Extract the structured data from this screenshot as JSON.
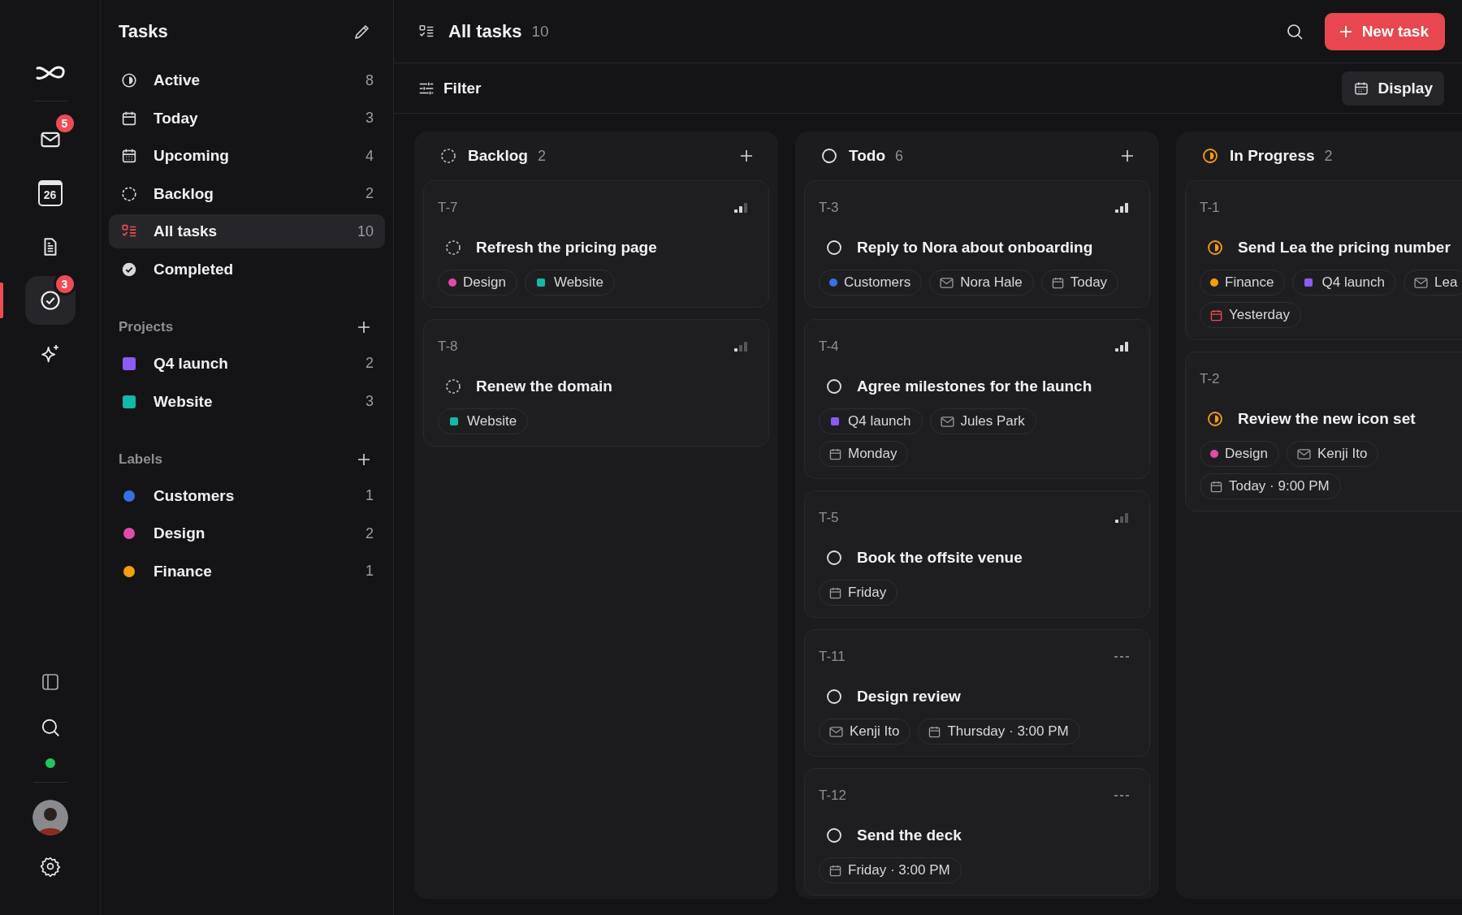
{
  "rail": {
    "top": [
      {
        "kind": "mail",
        "badge": "5",
        "selected": false
      },
      {
        "kind": "calendar",
        "day": "26",
        "selected": false
      },
      {
        "kind": "document",
        "selected": false
      },
      {
        "kind": "tasks",
        "badge": "3",
        "selected": true
      },
      {
        "kind": "sparkle",
        "selected": false
      }
    ],
    "bottom": [
      {
        "kind": "panel"
      },
      {
        "kind": "search"
      },
      {
        "kind": "status",
        "online": true
      },
      {
        "kind": "avatar"
      },
      {
        "kind": "settings"
      }
    ]
  },
  "sidebar": {
    "title": "Tasks",
    "views": [
      {
        "kind": "active",
        "label": "Active",
        "count": "8",
        "selected": false
      },
      {
        "kind": "today",
        "label": "Today",
        "count": "3",
        "selected": false
      },
      {
        "kind": "upcoming",
        "label": "Upcoming",
        "count": "4",
        "selected": false
      },
      {
        "kind": "backlog",
        "label": "Backlog",
        "count": "2",
        "selected": false
      },
      {
        "kind": "all",
        "label": "All tasks",
        "count": "10",
        "selected": true
      },
      {
        "kind": "completed",
        "label": "Completed",
        "selected": false
      }
    ],
    "projects": {
      "title": "Projects",
      "items": [
        {
          "label": "Q4 launch",
          "count": "2",
          "color": "#8b5cf6"
        },
        {
          "label": "Website",
          "count": "3",
          "color": "#14b8a6"
        }
      ]
    },
    "labels": {
      "title": "Labels",
      "items": [
        {
          "label": "Customers",
          "count": "1",
          "color": "#3b6fe8"
        },
        {
          "label": "Design",
          "count": "2",
          "color": "#e04ba8"
        },
        {
          "label": "Finance",
          "count": "1",
          "color": "#f59e0b"
        }
      ]
    }
  },
  "header": {
    "title": "All tasks",
    "count": "10",
    "new_button": "New task",
    "filter": "Filter",
    "display": "Display"
  },
  "columns": [
    {
      "kind": "backlog",
      "title": "Backlog",
      "count": "2",
      "cards": [
        {
          "id": "T-7",
          "kind": "medium",
          "title": "Refresh the pricing page",
          "chip_rows": [
            [
              {
                "kind": "label",
                "text": "Design",
                "color": "#e04ba8"
              },
              {
                "kind": "project",
                "text": "Website",
                "color": "#14b8a6"
              }
            ]
          ]
        },
        {
          "id": "T-8",
          "kind": "low",
          "title": "Renew the domain",
          "chip_rows": [
            [
              {
                "kind": "project",
                "text": "Website",
                "color": "#14b8a6"
              }
            ]
          ]
        }
      ]
    },
    {
      "kind": "todo",
      "title": "Todo",
      "count": "6",
      "cards": [
        {
          "id": "T-3",
          "kind": "high",
          "title": "Reply to Nora about onboarding",
          "chip_rows": [
            [
              {
                "kind": "label",
                "text": "Customers",
                "color": "#3b6fe8"
              },
              {
                "kind": "person",
                "text": "Nora Hale"
              },
              {
                "kind": "date",
                "text": "Today",
                "overdue": false
              }
            ]
          ]
        },
        {
          "id": "T-4",
          "kind": "high",
          "title": "Agree milestones for the launch",
          "chip_rows": [
            [
              {
                "kind": "project",
                "text": "Q4 launch",
                "color": "#8b5cf6"
              },
              {
                "kind": "person",
                "text": "Jules Park"
              }
            ],
            [
              {
                "kind": "date",
                "text": "Monday",
                "overdue": false
              }
            ]
          ]
        },
        {
          "id": "T-5",
          "kind": "low",
          "title": "Book the offsite venue",
          "chip_rows": [
            [
              {
                "kind": "date",
                "text": "Friday",
                "overdue": false
              }
            ]
          ]
        },
        {
          "id": "T-11",
          "kind": "none",
          "title": "Design review",
          "chip_rows": [
            [
              {
                "kind": "person",
                "text": "Kenji Ito"
              },
              {
                "kind": "date",
                "text": "Thursday · 3:00 PM",
                "overdue": false
              }
            ]
          ]
        },
        {
          "id": "T-12",
          "kind": "none",
          "title": "Send the deck",
          "chip_rows": [
            [
              {
                "kind": "date",
                "text": "Friday · 3:00 PM",
                "overdue": false
              }
            ]
          ]
        }
      ]
    },
    {
      "kind": "in_progress",
      "title": "In Progress",
      "count": "2",
      "cards": [
        {
          "id": "T-1",
          "title": "Send Lea the pricing number",
          "chip_rows": [
            [
              {
                "kind": "label",
                "text": "Finance",
                "color": "#f59e0b"
              },
              {
                "kind": "project",
                "text": "Q4 launch",
                "color": "#8b5cf6"
              },
              {
                "kind": "person",
                "text": "Lea"
              }
            ],
            [
              {
                "kind": "date",
                "text": "Yesterday",
                "overdue": true
              }
            ]
          ]
        },
        {
          "id": "T-2",
          "title": "Review the new icon set",
          "chip_rows": [
            [
              {
                "kind": "label",
                "text": "Design",
                "color": "#e04ba8"
              },
              {
                "kind": "person",
                "text": "Kenji Ito"
              }
            ],
            [
              {
                "kind": "date",
                "text": "Today · 9:00 PM",
                "overdue": false
              }
            ]
          ]
        }
      ]
    }
  ]
}
